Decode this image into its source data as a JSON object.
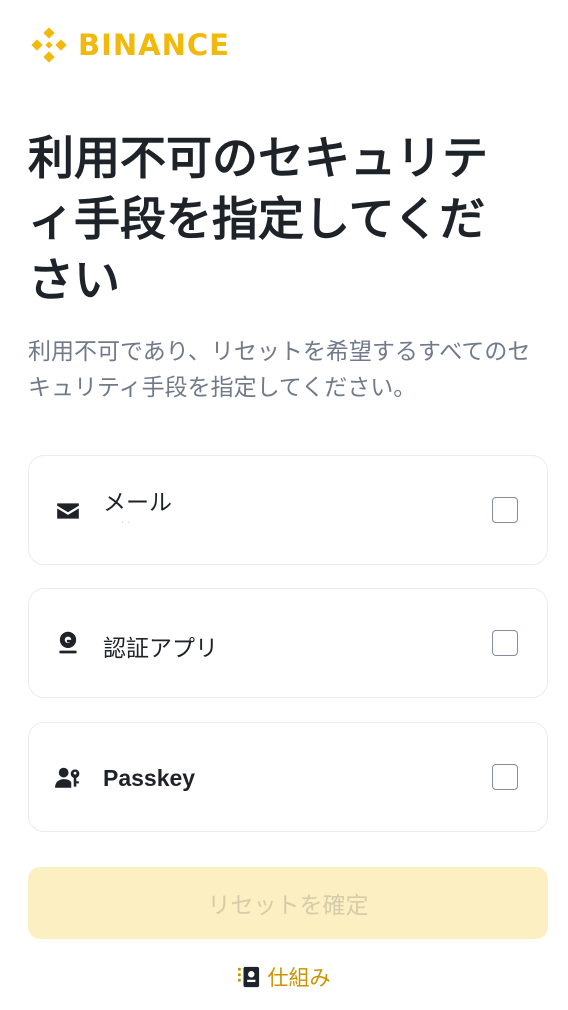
{
  "brand": {
    "name": "BINANCE",
    "logo_icon": "binance-diamond-logo",
    "color": "#F0B90B"
  },
  "page": {
    "title": "利用不可のセキュリティ手段を指定してください",
    "subtitle": "利用不可であり、リセットを希望するすべてのセキュリティ手段を指定してください。"
  },
  "options": [
    {
      "label": "メール",
      "sub": "· ·",
      "icon": "mail-icon",
      "checked": false
    },
    {
      "label": "認証アプリ",
      "icon": "authenticator-icon",
      "checked": false
    },
    {
      "label": "Passkey",
      "icon": "passkey-icon",
      "checked": false
    }
  ],
  "actions": {
    "submit_label": "リセットを確定",
    "how_label": "仕組み",
    "how_icon": "guide-book-icon"
  },
  "colors": {
    "accent": "#F0B90B",
    "link": "#C99400",
    "disabled_bg": "#FCEFC1",
    "disabled_text": "#D6CCAA"
  }
}
